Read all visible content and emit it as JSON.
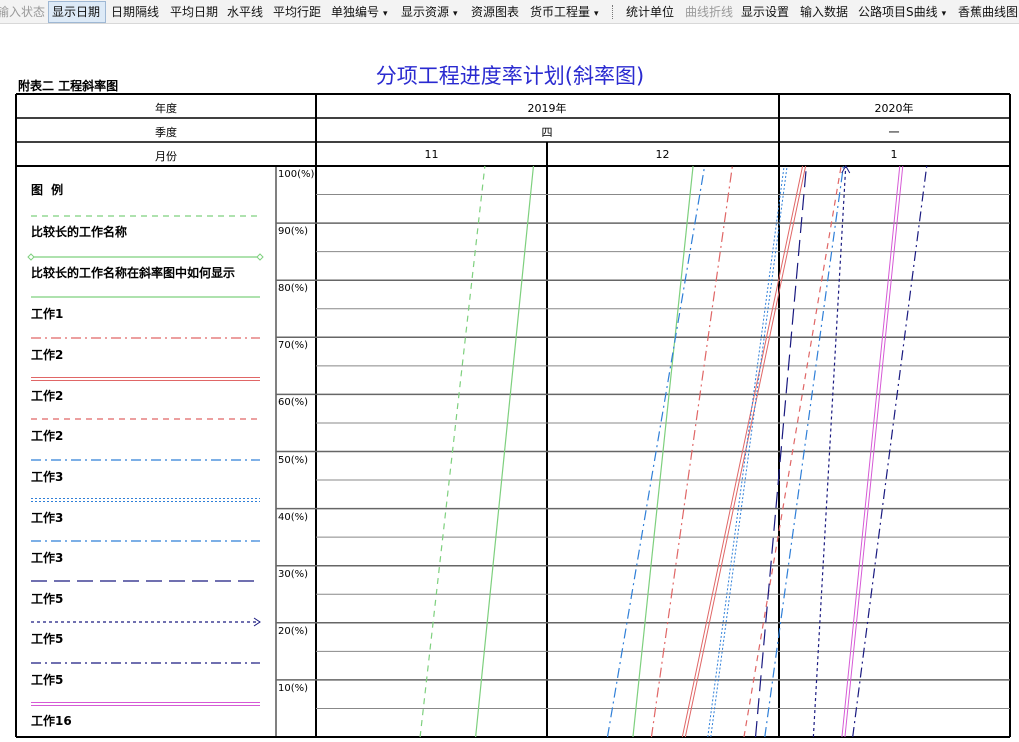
{
  "toolbar": {
    "items": [
      {
        "label": "输入状态",
        "state": "disabled"
      },
      {
        "label": "显示日期",
        "state": "active"
      },
      {
        "label": "日期隔线",
        "state": "normal"
      },
      {
        "label": "平均日期",
        "state": "normal"
      },
      {
        "label": "水平线",
        "state": "normal"
      },
      {
        "label": "平均行距",
        "state": "normal"
      },
      {
        "label": "单独编号",
        "state": "dropdown"
      },
      {
        "label": "显示资源",
        "state": "dropdown"
      },
      {
        "label": "资源图表",
        "state": "normal"
      },
      {
        "label": "货币工程量",
        "state": "dropdown"
      },
      {
        "label": "统计单位",
        "state": "normal"
      },
      {
        "label": "曲线折线",
        "state": "disabled"
      },
      {
        "label": "显示设置",
        "state": "normal"
      },
      {
        "label": "输入数据",
        "state": "normal"
      },
      {
        "label": "公路项目S曲线",
        "state": "dropdown"
      },
      {
        "label": "香蕉曲线图",
        "state": "normal"
      }
    ],
    "dropdown_glyph": "▾"
  },
  "chart": {
    "title": "分项工程进度率计划(斜率图)",
    "caption": "附表二    工程斜率图",
    "header": {
      "row_labels": [
        "年度",
        "季度",
        "月份"
      ],
      "years": [
        "2019年",
        "2020年"
      ],
      "quarters": [
        "四",
        "一"
      ],
      "months": [
        "11",
        "12",
        "1"
      ]
    },
    "legend_title": "图  例",
    "percent_labels": [
      "100(%)",
      "90(%)",
      "80(%)",
      "70(%)",
      "60(%)",
      "50(%)",
      "40(%)",
      "30(%)",
      "20(%)",
      "10(%)"
    ],
    "colors": {
      "title": "#2a2ad0",
      "grid": "#000000"
    }
  },
  "chart_data": {
    "type": "line",
    "title": "分项工程进度率计划(斜率图)",
    "xlabel": "月份",
    "ylabel": "",
    "x_categories": [
      "11",
      "12",
      "1"
    ],
    "ylim": [
      0,
      100
    ],
    "y_ticks": [
      10,
      20,
      30,
      40,
      50,
      60,
      70,
      80,
      90,
      100
    ],
    "series": [
      {
        "name": "比较长的工作名称",
        "color": "#7ed07e",
        "style": "dashed",
        "x": [
          4.5,
          7.3
        ],
        "y": [
          0,
          100
        ]
      },
      {
        "name": "比较长的工作名称在斜率图中如何显示",
        "color": "#7ed07e",
        "style": "diamond-ends",
        "x": [
          6.9,
          9.4
        ],
        "y": [
          0,
          100
        ]
      },
      {
        "name": "工作1",
        "color": "#7ed07e",
        "style": "solid",
        "x": [
          13.7,
          16.3
        ],
        "y": [
          0,
          100
        ]
      },
      {
        "name": "工作2",
        "color": "#e06666",
        "style": "dashdot",
        "x": [
          14.5,
          18.0
        ],
        "y": [
          0,
          100
        ]
      },
      {
        "name": "工作2",
        "color": "#e06666",
        "style": "double",
        "x": [
          15.9,
          21.1
        ],
        "y": [
          0,
          100
        ]
      },
      {
        "name": "工作2",
        "color": "#e06666",
        "style": "dashed",
        "x": [
          18.5,
          22.7
        ],
        "y": [
          0,
          100
        ]
      },
      {
        "name": "工作3",
        "color": "#2f7fd8",
        "style": "dashdot",
        "x": [
          12.6,
          16.8
        ],
        "y": [
          0,
          100
        ]
      },
      {
        "name": "工作3",
        "color": "#2f7fd8",
        "style": "dotted-double",
        "x": [
          17.0,
          20.3
        ],
        "y": [
          0,
          100
        ]
      },
      {
        "name": "工作3",
        "color": "#2f7fd8",
        "style": "dashdot",
        "x": [
          19.4,
          22.8
        ],
        "y": [
          0,
          100
        ]
      },
      {
        "name": "工作5",
        "color": "#1a1a80",
        "style": "longdash",
        "x": [
          19.0,
          21.2
        ],
        "y": [
          0,
          100
        ]
      },
      {
        "name": "工作5",
        "color": "#1a1a80",
        "style": "dotted-arrow",
        "x": [
          21.5,
          22.9
        ],
        "y": [
          0,
          100
        ]
      },
      {
        "name": "工作5",
        "color": "#1a1a80",
        "style": "dashdot",
        "x": [
          23.2,
          26.4
        ],
        "y": [
          0,
          100
        ]
      },
      {
        "name": "工作16",
        "color": "#d65ad6",
        "style": "double",
        "x": [
          22.8,
          25.3
        ],
        "y": [
          0,
          100
        ]
      }
    ]
  }
}
